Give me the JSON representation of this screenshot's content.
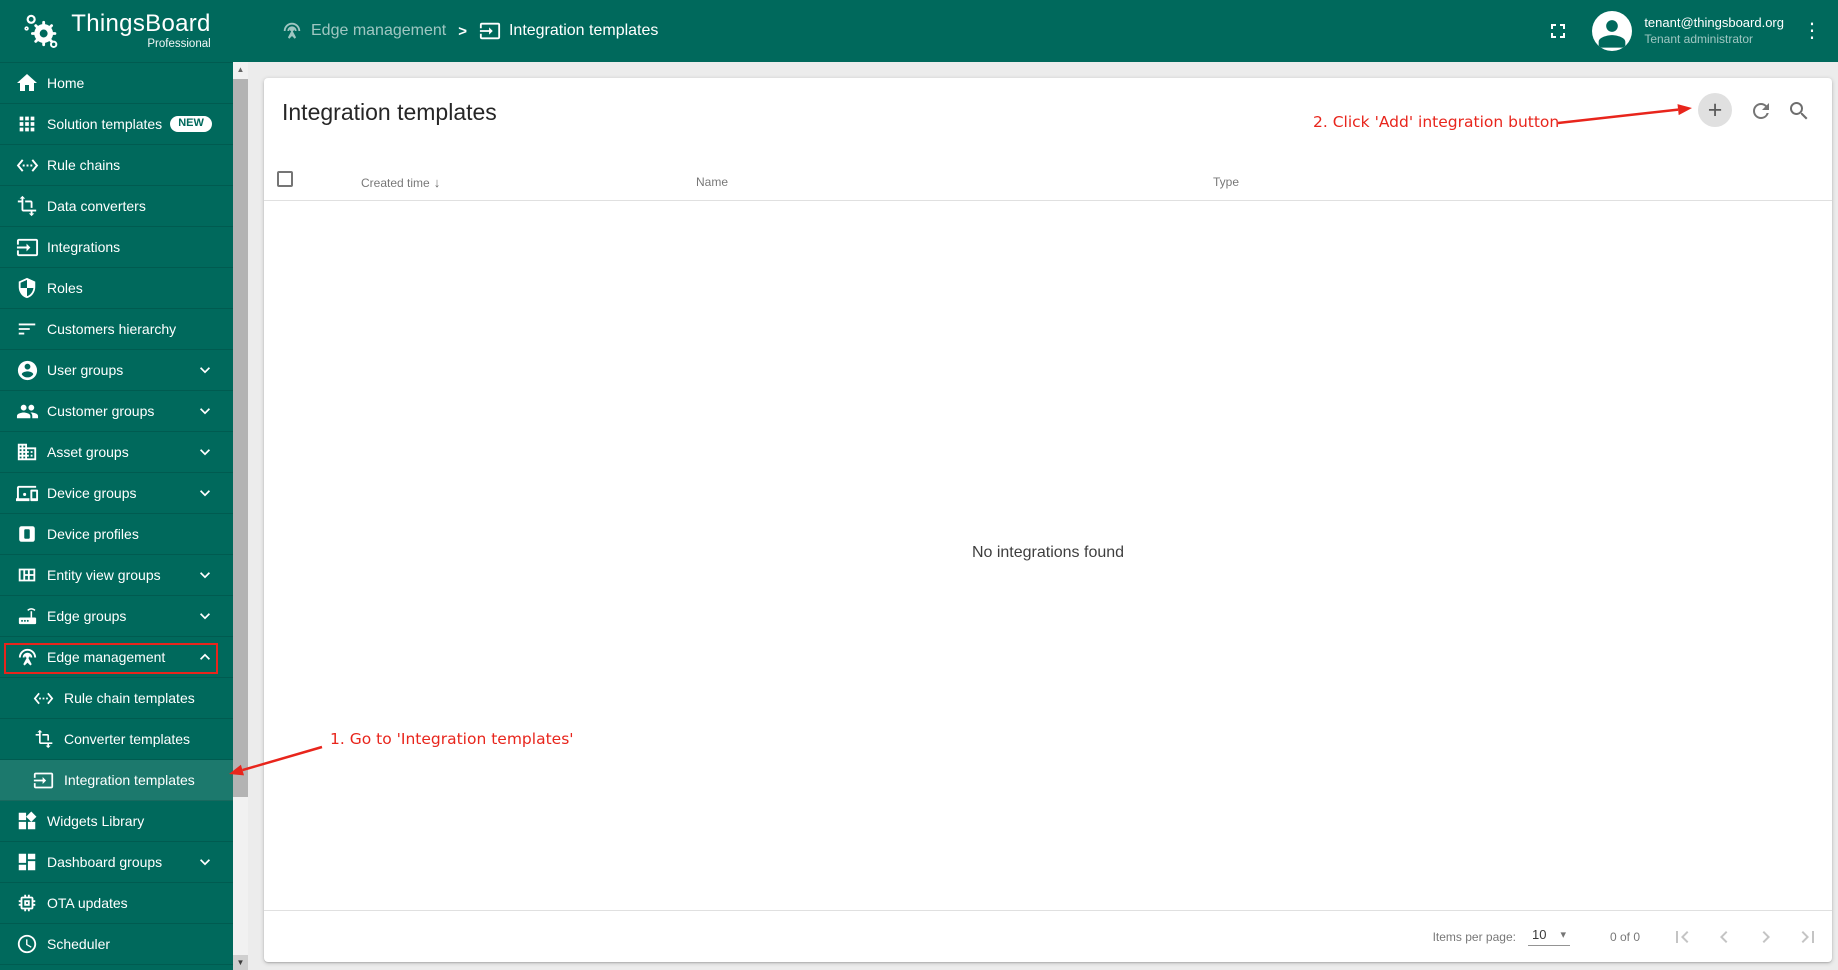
{
  "app": {
    "name": "ThingsBoard",
    "edition": "Professional"
  },
  "header": {
    "separator": ">",
    "breadcrumb": [
      {
        "label": "Edge management",
        "icon": "antenna-icon"
      },
      {
        "label": "Integration templates",
        "icon": "integration-icon"
      }
    ],
    "user": {
      "email": "tenant@thingsboard.org",
      "role": "Tenant administrator"
    }
  },
  "sidebar": {
    "items": [
      {
        "label": "Home",
        "icon": "home-icon"
      },
      {
        "label": "Solution templates",
        "icon": "apps-icon",
        "badge": "NEW"
      },
      {
        "label": "Rule chains",
        "icon": "rule-chain-icon"
      },
      {
        "label": "Data converters",
        "icon": "data-converter-icon"
      },
      {
        "label": "Integrations",
        "icon": "integration-icon"
      },
      {
        "label": "Roles",
        "icon": "shield-icon"
      },
      {
        "label": "Customers hierarchy",
        "icon": "hierarchy-icon"
      },
      {
        "label": "User groups",
        "icon": "user-circle-icon",
        "chevron": "down"
      },
      {
        "label": "Customer groups",
        "icon": "people-icon",
        "chevron": "down"
      },
      {
        "label": "Asset groups",
        "icon": "building-icon",
        "chevron": "down"
      },
      {
        "label": "Device groups",
        "icon": "devices-icon",
        "chevron": "down"
      },
      {
        "label": "Device profiles",
        "icon": "device-profile-icon"
      },
      {
        "label": "Entity view groups",
        "icon": "entity-view-icon",
        "chevron": "down"
      },
      {
        "label": "Edge groups",
        "icon": "router-icon",
        "chevron": "down"
      },
      {
        "label": "Edge management",
        "icon": "antenna-icon",
        "chevron": "up",
        "annotated": true
      },
      {
        "label": "Rule chain templates",
        "icon": "rule-chain-icon",
        "sub": true
      },
      {
        "label": "Converter templates",
        "icon": "data-converter-icon",
        "sub": true
      },
      {
        "label": "Integration templates",
        "icon": "integration-icon",
        "sub": true,
        "selected": true
      },
      {
        "label": "Widgets Library",
        "icon": "widgets-icon"
      },
      {
        "label": "Dashboard groups",
        "icon": "dashboard-icon",
        "chevron": "down"
      },
      {
        "label": "OTA updates",
        "icon": "chip-icon"
      },
      {
        "label": "Scheduler",
        "icon": "clock-icon"
      }
    ]
  },
  "main": {
    "title": "Integration templates",
    "table": {
      "headers": [
        "Created time",
        "Name",
        "Type"
      ]
    },
    "empty_text": "No integrations found",
    "pagination": {
      "items_per_page_label": "Items per page:",
      "page_size": "10",
      "range": "0 of 0"
    }
  },
  "annotations": {
    "step1_text": "1. Go to 'Integration templates'",
    "step2_text": "2. Click 'Add' integration button",
    "color": "#e8251c"
  },
  "glyphs": {
    "plus": "+",
    "kebab": "⋮",
    "caret": "▾",
    "sort_desc": "↓",
    "scroll_up": "▲",
    "scroll_down": "▼"
  },
  "colors": {
    "primary": "#00695C",
    "sidebar_selected_overlay": "rgba(255,255,255,0.11)",
    "content_background": "#ececec",
    "annotation_red": "#e8251c"
  }
}
